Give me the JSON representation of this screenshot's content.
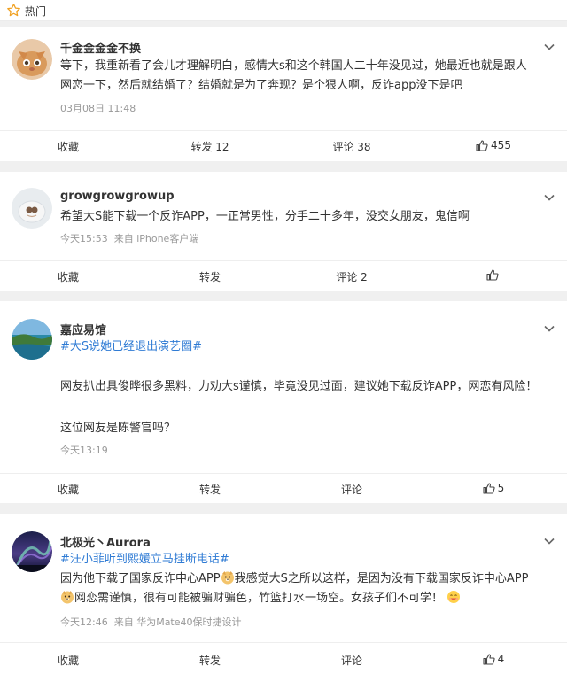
{
  "header": {
    "title": "热门",
    "icon": "star-icon"
  },
  "posts": [
    {
      "username": "千金金金金不换",
      "text": "等下，我重新看了会儿才理解明白，感情大s和这个韩国人二十年没见过，她最近也就是跟人网恋一下，然后就结婚了？结婚就是为了奔现？是个狠人啊，反诈app没下是吧",
      "line1": "等下，我重新看了会儿才理解明白，感情大s和这个韩国人二十年没见过，她最近也就是跟人",
      "line2": "网恋一下，然后就结婚了？结婚就是为了奔现？是个狠人啊，反诈app没下是吧",
      "time": "03月08日 11:48",
      "actions": {
        "collect": "收藏",
        "repost": "转发 12",
        "comment": "评论 38",
        "like": "455"
      }
    },
    {
      "username": "growgrowgrowup",
      "line1": "希望大S能下载一个反诈APP，一正常男性，分手二十多年，没交女朋友，鬼信啊",
      "time": "今天15:53",
      "source": "来自 iPhone客户端",
      "actions": {
        "collect": "收藏",
        "repost": "转发",
        "comment": "评论 2",
        "like": ""
      }
    },
    {
      "username": "嘉应易馆",
      "topic": "#大S说她已经退出演艺圈#",
      "line1": "网友扒出具俊晔很多黑料，力劝大s谨慎，毕竟没见过面，建议她下载反诈APP，网恋有风险！",
      "line2": "这位网友是陈警官吗？",
      "time": "今天13:19",
      "actions": {
        "collect": "收藏",
        "repost": "转发",
        "comment": "评论",
        "like": "5"
      }
    },
    {
      "username": "北极光丶Aurora",
      "topic": "#汪小菲听到熙媛立马挂断电话#",
      "line1a": "因为他下载了国家反诈中心APP",
      "line1b": "我感觉大S之所以这样，是因为没有下载国家反诈中心APP",
      "line2": "网恋需谨慎，很有可能被骗财骗色，竹篮打水一场空。女孩子们不可学！",
      "time": "今天12:46",
      "source": "来自 华为Mate40保时捷设计",
      "actions": {
        "collect": "收藏",
        "repost": "转发",
        "comment": "评论",
        "like": "4"
      }
    }
  ],
  "colors": {
    "topic": "#2f7bd4",
    "meta": "#999999",
    "background": "#f0f0f0"
  }
}
